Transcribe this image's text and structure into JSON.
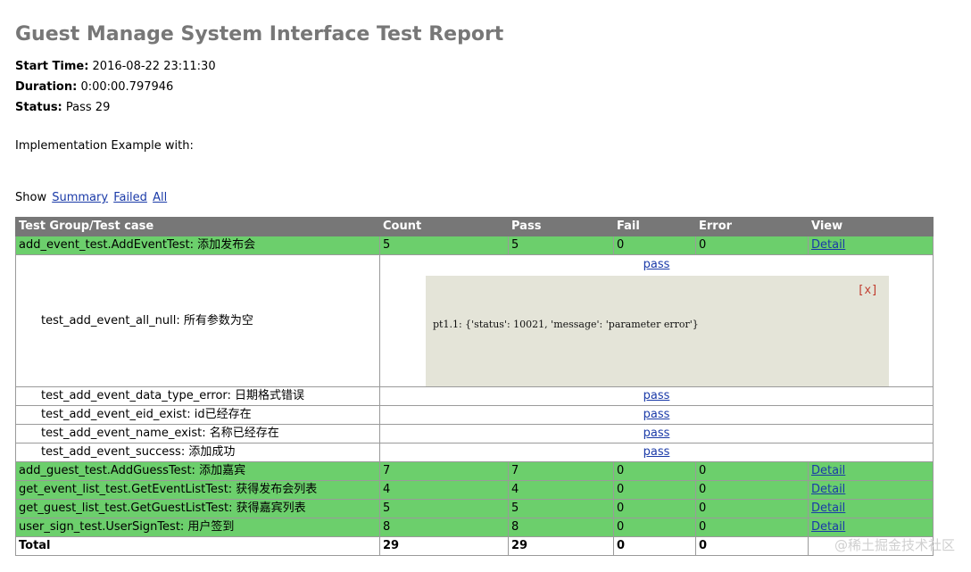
{
  "report": {
    "title": "Guest Manage System Interface Test Report",
    "start_time_label": "Start Time:",
    "start_time": "2016-08-22 23:11:30",
    "duration_label": "Duration:",
    "duration": "0:00:00.797946",
    "status_label": "Status:",
    "status": "Pass 29",
    "description": "Implementation Example with:"
  },
  "filter": {
    "label": "Show",
    "summary": "Summary",
    "failed": "Failed",
    "all": "All"
  },
  "table": {
    "headers": [
      "Test Group/Test case",
      "Count",
      "Pass",
      "Fail",
      "Error",
      "View"
    ],
    "group1": {
      "name": "add_event_test.AddEventTest: 添加发布会",
      "count": "5",
      "pass": "5",
      "fail": "0",
      "error": "0",
      "view": "Detail"
    },
    "cases": [
      {
        "name": "test_add_event_all_null: 所有参数为空",
        "result": "pass"
      },
      {
        "name": "test_add_event_data_type_error: 日期格式错误",
        "result": "pass"
      },
      {
        "name": "test_add_event_eid_exist: id已经存在",
        "result": "pass"
      },
      {
        "name": "test_add_event_name_exist: 名称已经存在",
        "result": "pass"
      },
      {
        "name": "test_add_event_success: 添加成功",
        "result": "pass"
      }
    ],
    "popup": {
      "close": "[x]",
      "text": "pt1.1: {'status': 10021, 'message': 'parameter error'}"
    },
    "groups": [
      {
        "name": "add_guest_test.AddGuessTest: 添加嘉宾",
        "count": "7",
        "pass": "7",
        "fail": "0",
        "error": "0",
        "view": "Detail"
      },
      {
        "name": "get_event_list_test.GetEventListTest: 获得发布会列表",
        "count": "4",
        "pass": "4",
        "fail": "0",
        "error": "0",
        "view": "Detail"
      },
      {
        "name": "get_guest_list_test.GetGuestListTest: 获得嘉宾列表",
        "count": "5",
        "pass": "5",
        "fail": "0",
        "error": "0",
        "view": "Detail"
      },
      {
        "name": "user_sign_test.UserSignTest: 用户签到",
        "count": "8",
        "pass": "8",
        "fail": "0",
        "error": "0",
        "view": "Detail"
      }
    ],
    "total": {
      "label": "Total",
      "count": "29",
      "pass": "29",
      "fail": "0",
      "error": "0"
    }
  },
  "watermark": "@稀土掘金技术社区",
  "colors": {
    "header_bg": "#777777",
    "pass_row_bg": "#6ccf6c",
    "popup_bg": "#e4e4d8",
    "link": "#1a3aa8"
  }
}
